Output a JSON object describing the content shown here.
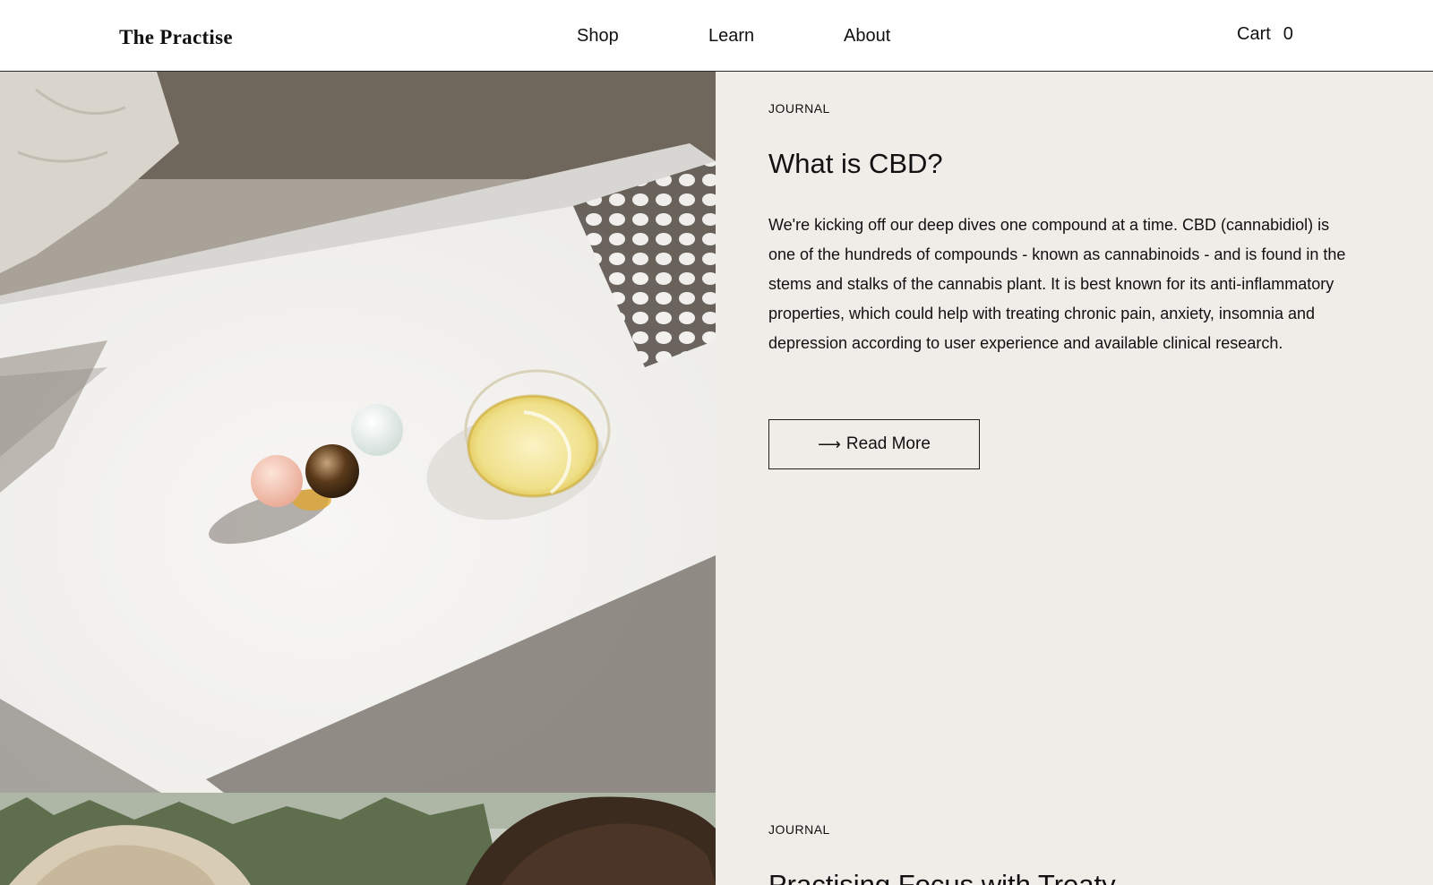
{
  "header": {
    "logo": "The Practise",
    "nav": [
      {
        "label": "Shop"
      },
      {
        "label": "Learn"
      },
      {
        "label": "About"
      }
    ],
    "cart_label": "Cart",
    "cart_count": "0"
  },
  "articles": [
    {
      "category": "JOURNAL",
      "title": "What is CBD?",
      "excerpt": "We're kicking off our deep dives one compound at a time. CBD (cannabidiol) is one of the hundreds of compounds - known as cannabinoids - and is found in the stems and stalks of the cannabis plant. It is best known for its anti-inflammatory properties, which could help with treating chronic pain, anxiety, insomnia and depression according to user experience and available clinical research.",
      "button_label": "Read More",
      "button_icon": "long-arrow-right-icon"
    },
    {
      "category": "JOURNAL",
      "title": "Practising Focus with Treaty"
    }
  ]
}
